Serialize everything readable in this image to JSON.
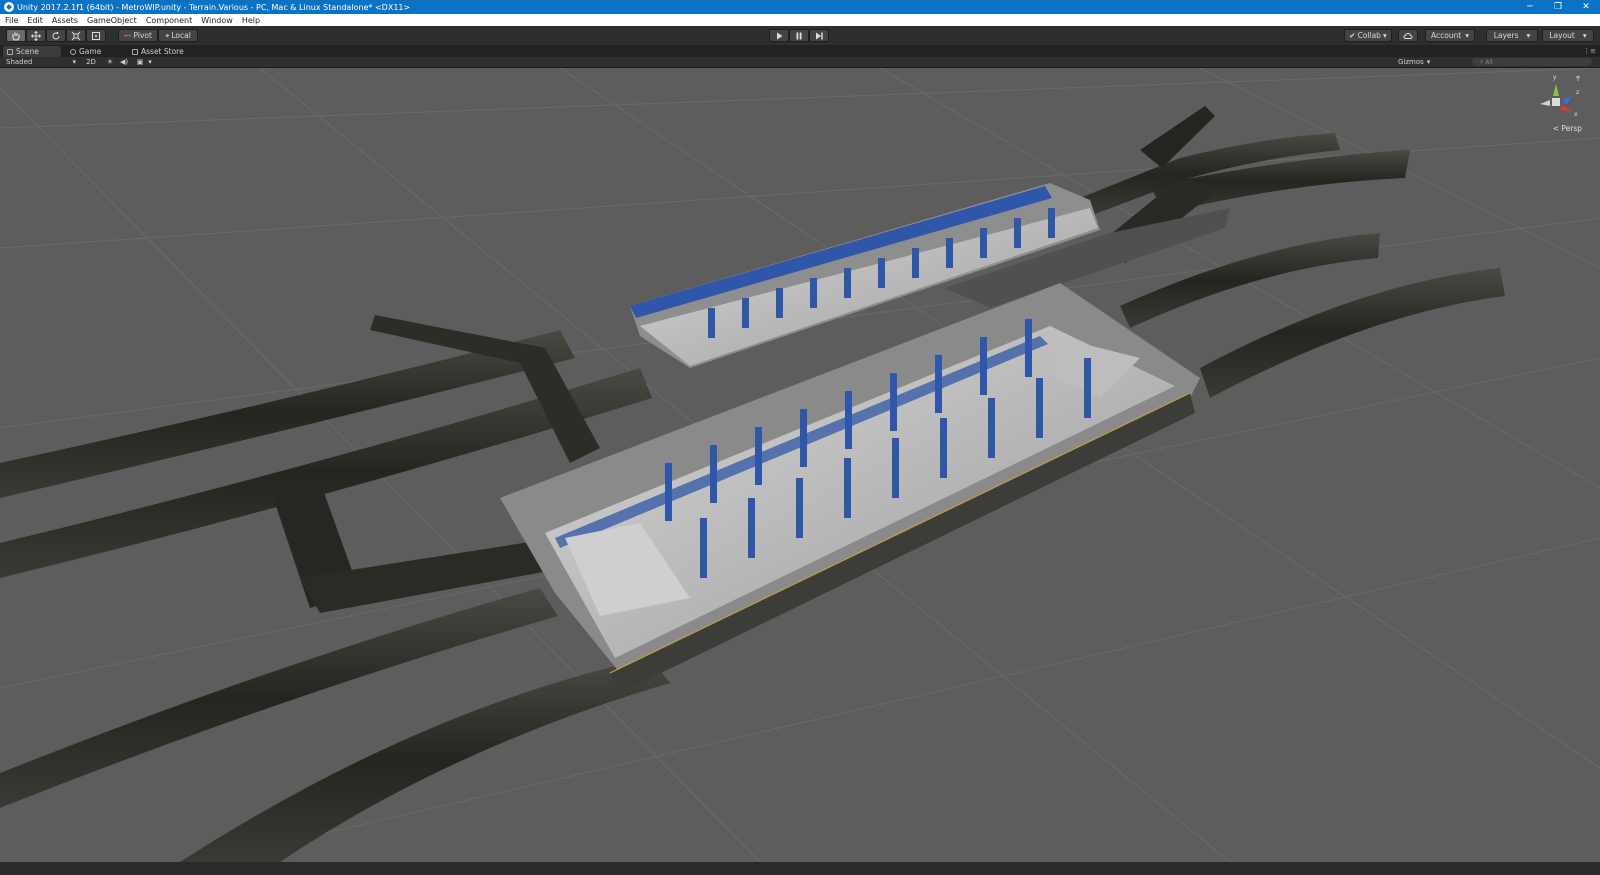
{
  "window": {
    "title": "Unity 2017.2.1f1 (64bit) - MetroWIP.unity - Terrain.Various - PC, Mac & Linux Standalone* <DX11>",
    "controls": [
      "─",
      "❐",
      "✕"
    ]
  },
  "menu": [
    "File",
    "Edit",
    "Assets",
    "GameObject",
    "Component",
    "Window",
    "Help"
  ],
  "toolbar": {
    "transform_tools": [
      "hand-tool-icon",
      "move-tool-icon",
      "rotate-tool-icon",
      "scale-tool-icon",
      "rect-tool-icon"
    ],
    "pivot_label": "Pivot",
    "local_label": "Local",
    "play_controls": [
      "play-icon",
      "pause-icon",
      "step-icon"
    ],
    "collab_label": "Collab",
    "account_label": "Account",
    "layers_label": "Layers",
    "layout_label": "Layout"
  },
  "tabs": [
    {
      "label": "Scene",
      "active": true
    },
    {
      "label": "Game",
      "active": false
    },
    {
      "label": "Asset Store",
      "active": false
    }
  ],
  "scene_bar": {
    "shading_mode": "Shaded",
    "mode_2d": "2D",
    "gizmos_label": "Gizmos",
    "search_placeholder": "All"
  },
  "viewport": {
    "projection_label": "Persp",
    "background_color": "#5d5d5d",
    "accent_blue": "#2f56a8"
  }
}
